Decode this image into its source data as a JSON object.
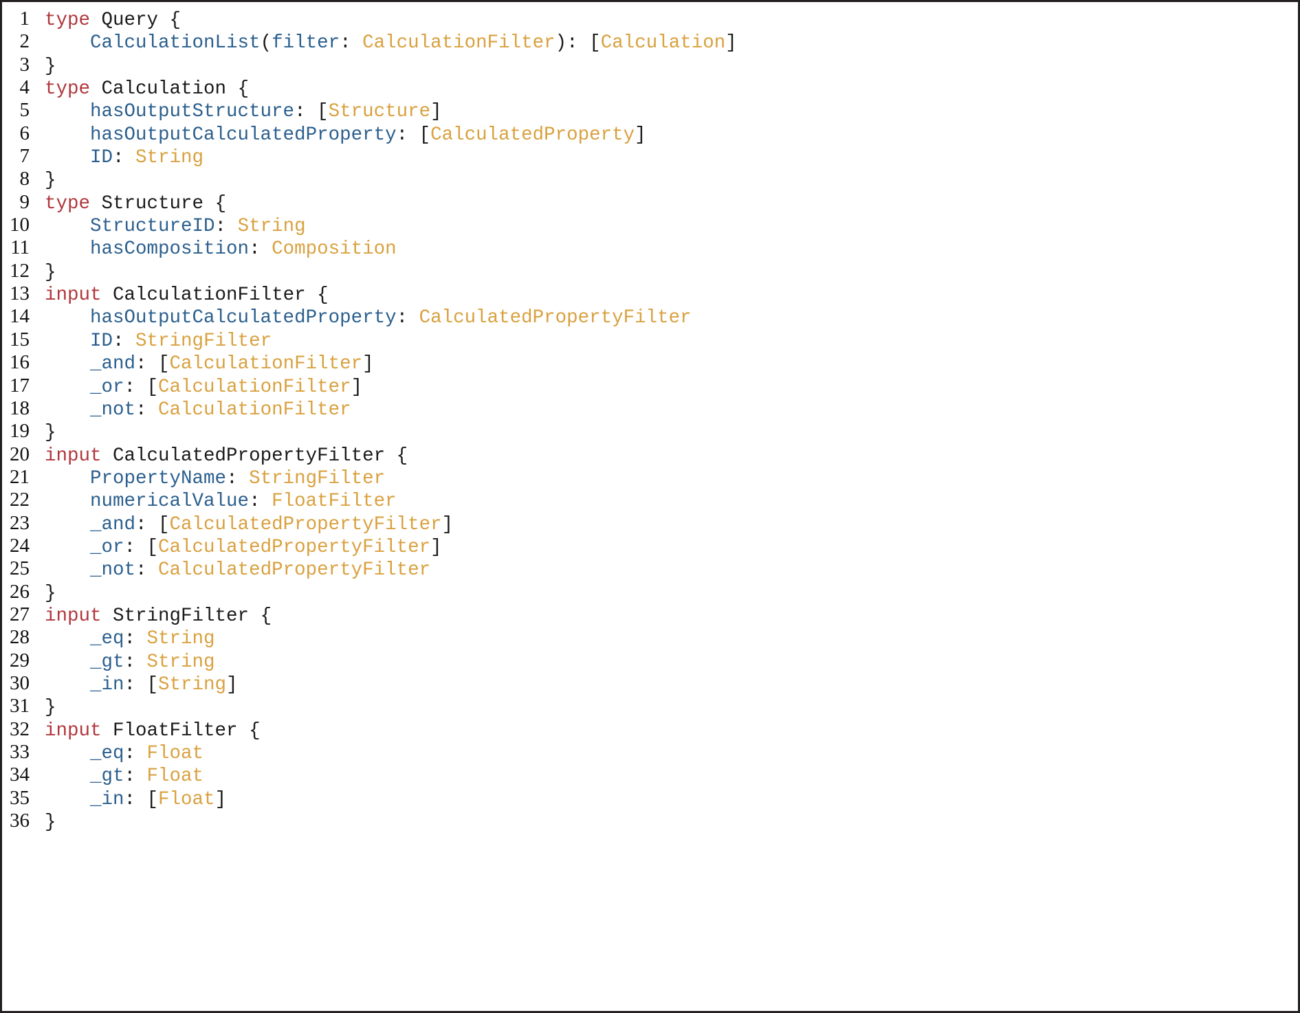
{
  "listing": {
    "language": "graphql",
    "border_color": "#231f20",
    "background_color": "#ffffff",
    "colors": {
      "keyword": "#b1373c",
      "field_name": "#2b5f8e",
      "type_reference": "#d9a13f",
      "punctuation": "#1a1a1a",
      "type_name": "#1a1a1a",
      "line_number": "#111111"
    },
    "lines": [
      {
        "n": "1",
        "tokens": [
          {
            "t": "type",
            "c": "kw"
          },
          {
            "t": " ",
            "c": "plain"
          },
          {
            "t": "Query",
            "c": "typename"
          },
          {
            "t": " {",
            "c": "punc"
          }
        ]
      },
      {
        "n": "2",
        "tokens": [
          {
            "t": "    ",
            "c": "plain"
          },
          {
            "t": "CalculationList",
            "c": "field"
          },
          {
            "t": "(",
            "c": "punc"
          },
          {
            "t": "filter",
            "c": "field"
          },
          {
            "t": ": ",
            "c": "punc"
          },
          {
            "t": "CalculationFilter",
            "c": "type"
          },
          {
            "t": "): [",
            "c": "punc"
          },
          {
            "t": "Calculation",
            "c": "type"
          },
          {
            "t": "]",
            "c": "punc"
          }
        ]
      },
      {
        "n": "3",
        "tokens": [
          {
            "t": "}",
            "c": "punc"
          }
        ]
      },
      {
        "n": "4",
        "tokens": [
          {
            "t": "type",
            "c": "kw"
          },
          {
            "t": " ",
            "c": "plain"
          },
          {
            "t": "Calculation",
            "c": "typename"
          },
          {
            "t": " {",
            "c": "punc"
          }
        ]
      },
      {
        "n": "5",
        "tokens": [
          {
            "t": "    ",
            "c": "plain"
          },
          {
            "t": "hasOutputStructure",
            "c": "field"
          },
          {
            "t": ": [",
            "c": "punc"
          },
          {
            "t": "Structure",
            "c": "type"
          },
          {
            "t": "]",
            "c": "punc"
          }
        ]
      },
      {
        "n": "6",
        "tokens": [
          {
            "t": "    ",
            "c": "plain"
          },
          {
            "t": "hasOutputCalculatedProperty",
            "c": "field"
          },
          {
            "t": ": [",
            "c": "punc"
          },
          {
            "t": "CalculatedProperty",
            "c": "type"
          },
          {
            "t": "]",
            "c": "punc"
          }
        ]
      },
      {
        "n": "7",
        "tokens": [
          {
            "t": "    ",
            "c": "plain"
          },
          {
            "t": "ID",
            "c": "field"
          },
          {
            "t": ": ",
            "c": "punc"
          },
          {
            "t": "String",
            "c": "type"
          }
        ]
      },
      {
        "n": "8",
        "tokens": [
          {
            "t": "}",
            "c": "punc"
          }
        ]
      },
      {
        "n": "9",
        "tokens": [
          {
            "t": "type",
            "c": "kw"
          },
          {
            "t": " ",
            "c": "plain"
          },
          {
            "t": "Structure",
            "c": "typename"
          },
          {
            "t": " {",
            "c": "punc"
          }
        ]
      },
      {
        "n": "10",
        "tokens": [
          {
            "t": "    ",
            "c": "plain"
          },
          {
            "t": "StructureID",
            "c": "field"
          },
          {
            "t": ": ",
            "c": "punc"
          },
          {
            "t": "String",
            "c": "type"
          }
        ]
      },
      {
        "n": "11",
        "tokens": [
          {
            "t": "    ",
            "c": "plain"
          },
          {
            "t": "hasComposition",
            "c": "field"
          },
          {
            "t": ": ",
            "c": "punc"
          },
          {
            "t": "Composition",
            "c": "type"
          }
        ]
      },
      {
        "n": "12",
        "tokens": [
          {
            "t": "}",
            "c": "punc"
          }
        ]
      },
      {
        "n": "13",
        "tokens": [
          {
            "t": "input",
            "c": "kw"
          },
          {
            "t": " ",
            "c": "plain"
          },
          {
            "t": "CalculationFilter",
            "c": "typename"
          },
          {
            "t": " {",
            "c": "punc"
          }
        ]
      },
      {
        "n": "14",
        "tokens": [
          {
            "t": "    ",
            "c": "plain"
          },
          {
            "t": "hasOutputCalculatedProperty",
            "c": "field"
          },
          {
            "t": ": ",
            "c": "punc"
          },
          {
            "t": "CalculatedPropertyFilter",
            "c": "type"
          }
        ]
      },
      {
        "n": "15",
        "tokens": [
          {
            "t": "    ",
            "c": "plain"
          },
          {
            "t": "ID",
            "c": "field"
          },
          {
            "t": ": ",
            "c": "punc"
          },
          {
            "t": "StringFilter",
            "c": "type"
          }
        ]
      },
      {
        "n": "16",
        "tokens": [
          {
            "t": "    ",
            "c": "plain"
          },
          {
            "t": "_and",
            "c": "field"
          },
          {
            "t": ": [",
            "c": "punc"
          },
          {
            "t": "CalculationFilter",
            "c": "type"
          },
          {
            "t": "]",
            "c": "punc"
          }
        ]
      },
      {
        "n": "17",
        "tokens": [
          {
            "t": "    ",
            "c": "plain"
          },
          {
            "t": "_or",
            "c": "field"
          },
          {
            "t": ": [",
            "c": "punc"
          },
          {
            "t": "CalculationFilter",
            "c": "type"
          },
          {
            "t": "]",
            "c": "punc"
          }
        ]
      },
      {
        "n": "18",
        "tokens": [
          {
            "t": "    ",
            "c": "plain"
          },
          {
            "t": "_not",
            "c": "field"
          },
          {
            "t": ": ",
            "c": "punc"
          },
          {
            "t": "CalculationFilter",
            "c": "type"
          }
        ]
      },
      {
        "n": "19",
        "tokens": [
          {
            "t": "}",
            "c": "punc"
          }
        ]
      },
      {
        "n": "20",
        "tokens": [
          {
            "t": "input",
            "c": "kw"
          },
          {
            "t": " ",
            "c": "plain"
          },
          {
            "t": "CalculatedPropertyFilter",
            "c": "typename"
          },
          {
            "t": " {",
            "c": "punc"
          }
        ]
      },
      {
        "n": "21",
        "tokens": [
          {
            "t": "    ",
            "c": "plain"
          },
          {
            "t": "PropertyName",
            "c": "field"
          },
          {
            "t": ": ",
            "c": "punc"
          },
          {
            "t": "StringFilter",
            "c": "type"
          }
        ]
      },
      {
        "n": "22",
        "tokens": [
          {
            "t": "    ",
            "c": "plain"
          },
          {
            "t": "numericalValue",
            "c": "field"
          },
          {
            "t": ": ",
            "c": "punc"
          },
          {
            "t": "FloatFilter",
            "c": "type"
          }
        ]
      },
      {
        "n": "23",
        "tokens": [
          {
            "t": "    ",
            "c": "plain"
          },
          {
            "t": "_and",
            "c": "field"
          },
          {
            "t": ": [",
            "c": "punc"
          },
          {
            "t": "CalculatedPropertyFilter",
            "c": "type"
          },
          {
            "t": "]",
            "c": "punc"
          }
        ]
      },
      {
        "n": "24",
        "tokens": [
          {
            "t": "    ",
            "c": "plain"
          },
          {
            "t": "_or",
            "c": "field"
          },
          {
            "t": ": [",
            "c": "punc"
          },
          {
            "t": "CalculatedPropertyFilter",
            "c": "type"
          },
          {
            "t": "]",
            "c": "punc"
          }
        ]
      },
      {
        "n": "25",
        "tokens": [
          {
            "t": "    ",
            "c": "plain"
          },
          {
            "t": "_not",
            "c": "field"
          },
          {
            "t": ": ",
            "c": "punc"
          },
          {
            "t": "CalculatedPropertyFilter",
            "c": "type"
          }
        ]
      },
      {
        "n": "26",
        "tokens": [
          {
            "t": "}",
            "c": "punc"
          }
        ]
      },
      {
        "n": "27",
        "tokens": [
          {
            "t": "input",
            "c": "kw"
          },
          {
            "t": " ",
            "c": "plain"
          },
          {
            "t": "StringFilter",
            "c": "typename"
          },
          {
            "t": " {",
            "c": "punc"
          }
        ]
      },
      {
        "n": "28",
        "tokens": [
          {
            "t": "    ",
            "c": "plain"
          },
          {
            "t": "_eq",
            "c": "field"
          },
          {
            "t": ": ",
            "c": "punc"
          },
          {
            "t": "String",
            "c": "type"
          }
        ]
      },
      {
        "n": "29",
        "tokens": [
          {
            "t": "    ",
            "c": "plain"
          },
          {
            "t": "_gt",
            "c": "field"
          },
          {
            "t": ": ",
            "c": "punc"
          },
          {
            "t": "String",
            "c": "type"
          }
        ]
      },
      {
        "n": "30",
        "tokens": [
          {
            "t": "    ",
            "c": "plain"
          },
          {
            "t": "_in",
            "c": "field"
          },
          {
            "t": ": [",
            "c": "punc"
          },
          {
            "t": "String",
            "c": "type"
          },
          {
            "t": "]",
            "c": "punc"
          }
        ]
      },
      {
        "n": "31",
        "tokens": [
          {
            "t": "}",
            "c": "punc"
          }
        ]
      },
      {
        "n": "32",
        "tokens": [
          {
            "t": "input",
            "c": "kw"
          },
          {
            "t": " ",
            "c": "plain"
          },
          {
            "t": "FloatFilter",
            "c": "typename"
          },
          {
            "t": " {",
            "c": "punc"
          }
        ]
      },
      {
        "n": "33",
        "tokens": [
          {
            "t": "    ",
            "c": "plain"
          },
          {
            "t": "_eq",
            "c": "field"
          },
          {
            "t": ": ",
            "c": "punc"
          },
          {
            "t": "Float",
            "c": "type"
          }
        ]
      },
      {
        "n": "34",
        "tokens": [
          {
            "t": "    ",
            "c": "plain"
          },
          {
            "t": "_gt",
            "c": "field"
          },
          {
            "t": ": ",
            "c": "punc"
          },
          {
            "t": "Float",
            "c": "type"
          }
        ]
      },
      {
        "n": "35",
        "tokens": [
          {
            "t": "    ",
            "c": "plain"
          },
          {
            "t": "_in",
            "c": "field"
          },
          {
            "t": ": [",
            "c": "punc"
          },
          {
            "t": "Float",
            "c": "type"
          },
          {
            "t": "]",
            "c": "punc"
          }
        ]
      },
      {
        "n": "36",
        "tokens": [
          {
            "t": "}",
            "c": "punc"
          }
        ]
      }
    ]
  }
}
